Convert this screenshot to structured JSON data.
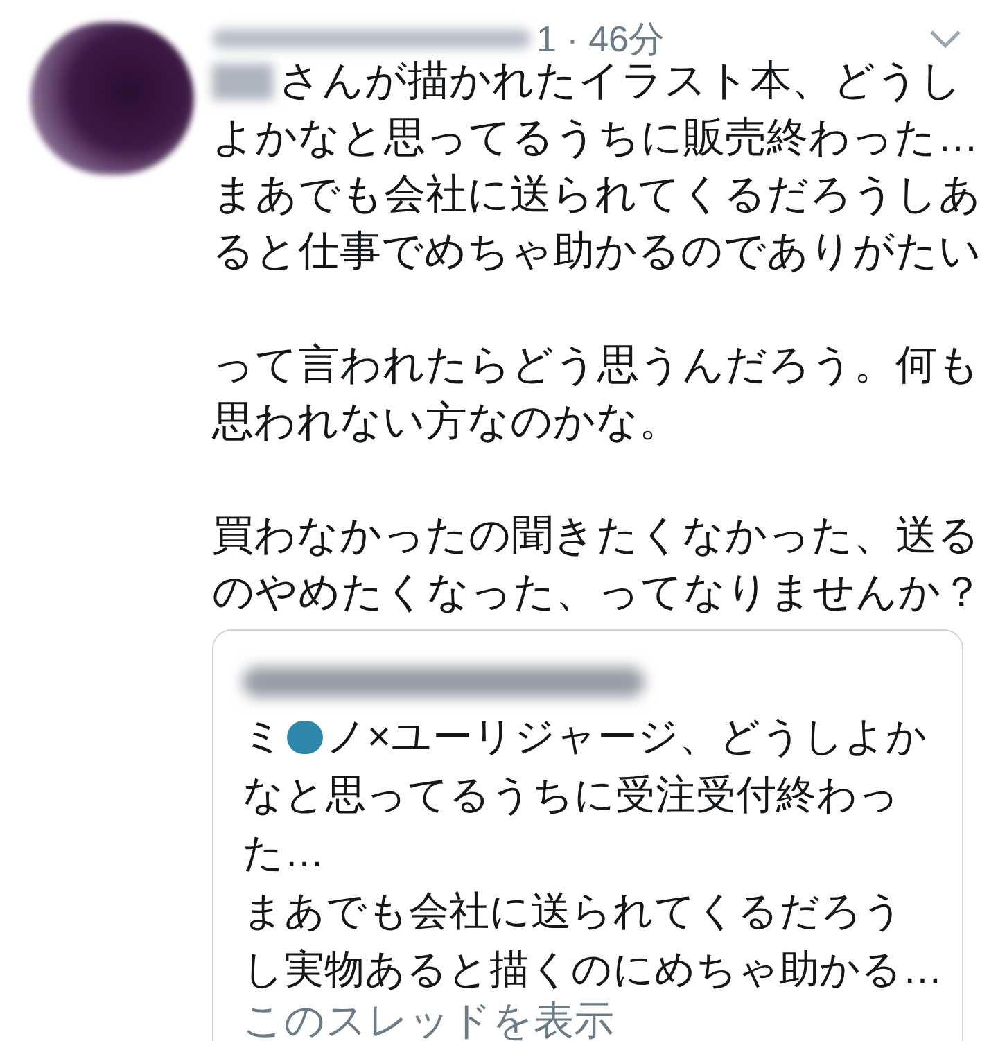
{
  "tweet": {
    "meta": "1 · 46分",
    "body": [
      {
        "lines": [
          "さんが描かれたイラスト本、どうし",
          "よかなと思ってるうちに販売終わった…",
          "まあでも会社に送られてくるだろうしあ",
          "ると仕事でめちゃ助かるのでありがたい"
        ]
      },
      {
        "lines": [
          "って言われたらどう思うんだろう。何も",
          "思われない方なのかな。"
        ]
      },
      {
        "lines": [
          "買わなかったの聞きたくなかった、送る",
          "のやめたくなった、ってなりませんか？"
        ]
      }
    ],
    "quote": {
      "text_before": "ミ",
      "text_after": "ノ×ユーリジャージ、どうしよか",
      "lines": [
        "なと思ってるうちに受注受付終わっ",
        "た…",
        "まあでも会社に送られてくるだろう",
        "し実物あると描くのにめちゃ助かる…"
      ],
      "link": "このスレッドを表示"
    }
  }
}
